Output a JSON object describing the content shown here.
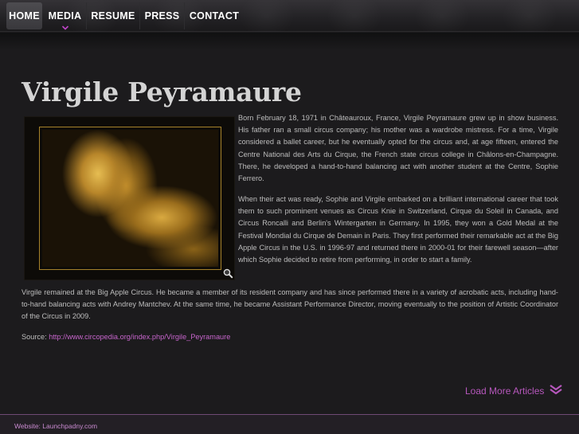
{
  "nav": {
    "items": [
      {
        "label": "HOME",
        "active": true
      },
      {
        "label": "MEDIA",
        "has_submenu": true
      },
      {
        "label": "RESUME"
      },
      {
        "label": "PRESS"
      },
      {
        "label": "CONTACT"
      }
    ],
    "submenu_icon": "chevron-down-icon"
  },
  "article": {
    "title": "Virgile Peyramaure",
    "image_icon": "zoom-icon",
    "paragraphs": [
      "Born February 18, 1971 in Châteauroux, France, Virgile Peyramaure grew up in show business. His father ran a small circus company; his mother was a wardrobe mistress. For a time, Virgile considered a ballet career, but he eventually opted for the circus and, at age fifteen, entered the Centre National des Arts du Cirque, the French state circus college in Châlons-en-Champagne. There, he developed a hand-to-hand balancing act with another student at the Centre, Sophie Ferrero.",
      "When their act was ready, Sophie and Virgile embarked on a brilliant international career that took them to such prominent venues as Circus Knie in Switzerland, Cirque du Soleil in Canada, and Circus Roncalli and Berlin's Wintergarten in Germany. In 1995, they won a Gold Medal at the Festival Mondial du Cirque de Demain in Paris. They first performed their remarkable act at the Big Apple Circus in the U.S. in 1996-97 and returned there in 2000-01 for their farewell season—after which Sophie decided to retire from performing, in order to start a family.",
      "Virgile remained at the Big Apple Circus. He became a member of its resident company and has since performed there in a variety of acrobatic acts, including hand-to-hand balancing acts with Andrey Mantchev. At the same time, he became Assistant Performance Director, moving eventually to the position of Artistic Coordinator of the Circus in 2009."
    ],
    "source_label": "Source: ",
    "source_link": "http://www.circopedia.org/index.php/Virgile_Peyramaure"
  },
  "load_more": {
    "label": "Load More Articles",
    "icon": "double-chevron-down-icon"
  },
  "footer": {
    "text": "Website: Launchpadny.com"
  },
  "colors": {
    "background": "#1c1b1d",
    "accent": "#b657bc",
    "link": "#c765cc",
    "text": "#bdbdbd",
    "title": "#d4d4d4",
    "frame_gold": "#a6822a"
  }
}
